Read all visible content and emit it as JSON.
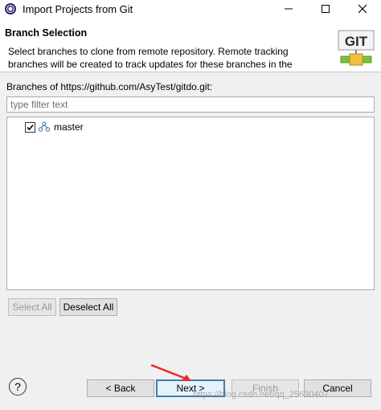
{
  "window": {
    "title": "Import Projects from Git"
  },
  "header": {
    "title": "Branch Selection",
    "description": "Select branches to clone from remote repository. Remote tracking branches will be created to track updates for these branches in the",
    "logo_text": "GIT"
  },
  "branches": {
    "label": "Branches of https://github.com/AsyTest/gitdo.git:",
    "filter_placeholder": "type filter text",
    "items": [
      {
        "label": "master",
        "checked": true
      }
    ]
  },
  "buttons": {
    "select_all": "Select All",
    "deselect_all": "Deselect All",
    "help": "?",
    "back": "< Back",
    "next": "Next >",
    "finish": "Finish",
    "cancel": "Cancel"
  },
  "watermark": "https://blog.csdn.net/qq_25630407",
  "colors": {
    "focus_border": "#3c7fb1",
    "arrow": "#e8282b"
  },
  "icons": {
    "app": "eclipse-icon",
    "branch": "git-branch-icon"
  }
}
